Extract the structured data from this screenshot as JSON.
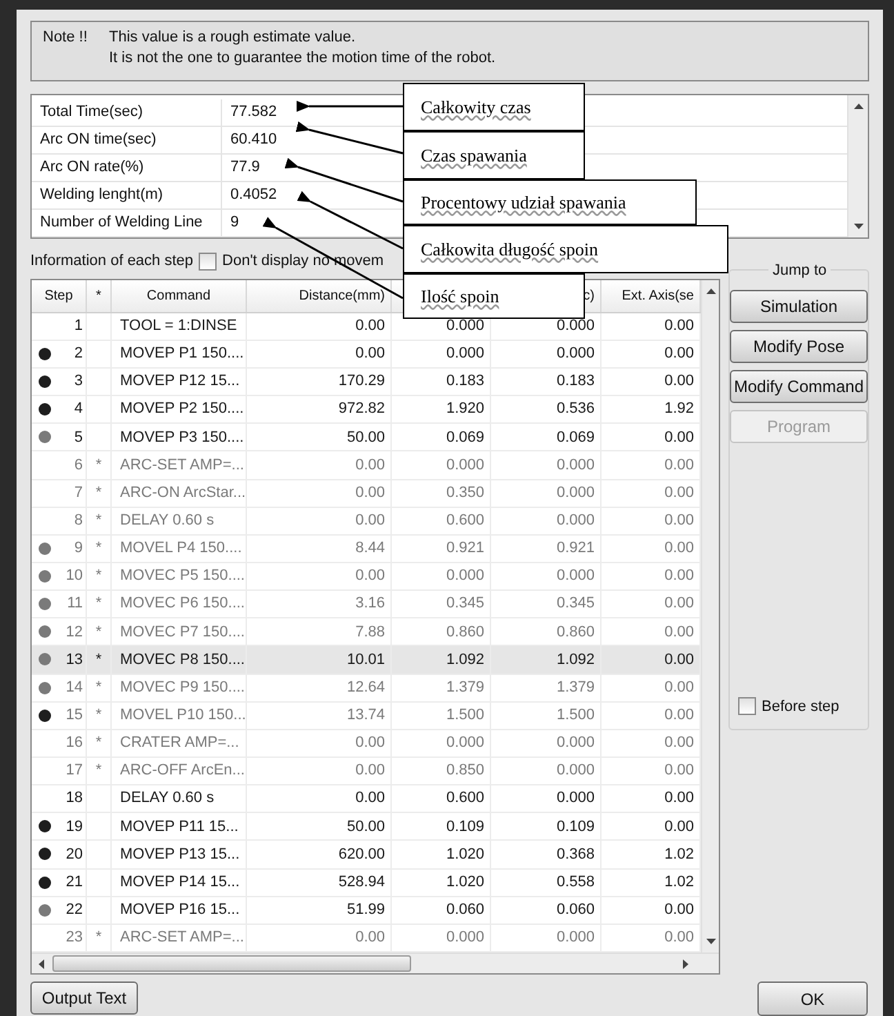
{
  "note": {
    "label": "Note !!",
    "lines": [
      "This value is a rough estimate value.",
      "It is not the one to guarantee the motion time of the robot."
    ]
  },
  "summary": [
    {
      "label": "Total Time(sec)",
      "value": "77.582"
    },
    {
      "label": "Arc ON time(sec)",
      "value": "60.410"
    },
    {
      "label": "Arc ON rate(%)",
      "value": "77.9"
    },
    {
      "label": "Welding lenght(m)",
      "value": "0.4052"
    },
    {
      "label": "Number of Welding Line",
      "value": "9"
    }
  ],
  "step_info": {
    "label": "Information of each step",
    "filter": {
      "label": "Don't display no movem",
      "checked": false
    }
  },
  "table": {
    "columns": [
      {
        "label": "Step"
      },
      {
        "label": "*"
      },
      {
        "label": "Command"
      },
      {
        "label": "Distance(mm)"
      },
      {},
      {
        "label": "c)"
      },
      {
        "label": "Ext. Axis(se"
      }
    ],
    "rows": [
      {
        "step": "1",
        "star": false,
        "command": "TOOL = 1:DINSE",
        "values": [
          "0.00",
          "0.000",
          "0.000",
          "0.00"
        ],
        "dimmed": false,
        "selected": false
      },
      {
        "color": "#1e1e1e",
        "step": "2",
        "star": false,
        "command": "MOVEP P1 150....",
        "values": [
          "0.00",
          "0.000",
          "0.000",
          "0.00"
        ],
        "dimmed": false,
        "selected": false
      },
      {
        "color": "#1e1e1e",
        "step": "3",
        "star": false,
        "command": "MOVEP P12 15...",
        "values": [
          "170.29",
          "0.183",
          "0.183",
          "0.00"
        ],
        "dimmed": false,
        "selected": false
      },
      {
        "color": "#1e1e1e",
        "step": "4",
        "star": false,
        "command": "MOVEP P2 150....",
        "values": [
          "972.82",
          "1.920",
          "0.536",
          "1.92"
        ],
        "dimmed": false,
        "selected": false
      },
      {
        "color": "#7a7a7a",
        "step": "5",
        "star": false,
        "command": "MOVEP P3 150....",
        "values": [
          "50.00",
          "0.069",
          "0.069",
          "0.00"
        ],
        "dimmed": false,
        "selected": false
      },
      {
        "step": "6",
        "star": true,
        "command": "ARC-SET AMP=...",
        "values": [
          "0.00",
          "0.000",
          "0.000",
          "0.00"
        ],
        "dimmed": true,
        "selected": false
      },
      {
        "step": "7",
        "star": true,
        "command": "ARC-ON ArcStar...",
        "values": [
          "0.00",
          "0.350",
          "0.000",
          "0.00"
        ],
        "dimmed": true,
        "selected": false
      },
      {
        "step": "8",
        "star": true,
        "command": "DELAY 0.60 s",
        "values": [
          "0.00",
          "0.600",
          "0.000",
          "0.00"
        ],
        "dimmed": true,
        "selected": false
      },
      {
        "color": "#7a7a7a",
        "step": "9",
        "star": true,
        "command": "MOVEL P4 150....",
        "values": [
          "8.44",
          "0.921",
          "0.921",
          "0.00"
        ],
        "dimmed": true,
        "selected": false
      },
      {
        "color": "#7a7a7a",
        "step": "10",
        "star": true,
        "command": "MOVEC P5 150....",
        "values": [
          "0.00",
          "0.000",
          "0.000",
          "0.00"
        ],
        "dimmed": true,
        "selected": false
      },
      {
        "color": "#7a7a7a",
        "step": "11",
        "star": true,
        "command": "MOVEC P6 150....",
        "values": [
          "3.16",
          "0.345",
          "0.345",
          "0.00"
        ],
        "dimmed": true,
        "selected": false
      },
      {
        "color": "#7a7a7a",
        "step": "12",
        "star": true,
        "command": "MOVEC P7 150....",
        "values": [
          "7.88",
          "0.860",
          "0.860",
          "0.00"
        ],
        "dimmed": true,
        "selected": false
      },
      {
        "color": "#7a7a7a",
        "step": "13",
        "star": true,
        "command": "MOVEC P8 150....",
        "values": [
          "10.01",
          "1.092",
          "1.092",
          "0.00"
        ],
        "dimmed": false,
        "selected": true
      },
      {
        "color": "#7a7a7a",
        "step": "14",
        "star": true,
        "command": "MOVEC P9 150....",
        "values": [
          "12.64",
          "1.379",
          "1.379",
          "0.00"
        ],
        "dimmed": true,
        "selected": false
      },
      {
        "color": "#1e1e1e",
        "step": "15",
        "star": true,
        "command": "MOVEL P10 150...",
        "values": [
          "13.74",
          "1.500",
          "1.500",
          "0.00"
        ],
        "dimmed": true,
        "selected": false
      },
      {
        "step": "16",
        "star": true,
        "command": "CRATER AMP=...",
        "values": [
          "0.00",
          "0.000",
          "0.000",
          "0.00"
        ],
        "dimmed": true,
        "selected": false
      },
      {
        "step": "17",
        "star": true,
        "command": "ARC-OFF ArcEn...",
        "values": [
          "0.00",
          "0.850",
          "0.000",
          "0.00"
        ],
        "dimmed": true,
        "selected": false
      },
      {
        "step": "18",
        "star": false,
        "command": "DELAY 0.60 s",
        "values": [
          "0.00",
          "0.600",
          "0.000",
          "0.00"
        ],
        "dimmed": false,
        "selected": false
      },
      {
        "color": "#1e1e1e",
        "step": "19",
        "star": false,
        "command": "MOVEP P11 15...",
        "values": [
          "50.00",
          "0.109",
          "0.109",
          "0.00"
        ],
        "dimmed": false,
        "selected": false
      },
      {
        "color": "#1e1e1e",
        "step": "20",
        "star": false,
        "command": "MOVEP P13 15...",
        "values": [
          "620.00",
          "1.020",
          "0.368",
          "1.02"
        ],
        "dimmed": false,
        "selected": false
      },
      {
        "color": "#1e1e1e",
        "step": "21",
        "star": false,
        "command": "MOVEP P14 15...",
        "values": [
          "528.94",
          "1.020",
          "0.558",
          "1.02"
        ],
        "dimmed": false,
        "selected": false
      },
      {
        "color": "#7a7a7a",
        "step": "22",
        "star": false,
        "command": "MOVEP P16 15...",
        "values": [
          "51.99",
          "0.060",
          "0.060",
          "0.00"
        ],
        "dimmed": false,
        "selected": false
      },
      {
        "step": "23",
        "star": true,
        "command": "ARC-SET AMP=...",
        "values": [
          "0.00",
          "0.000",
          "0.000",
          "0.00"
        ],
        "dimmed": true,
        "selected": false
      }
    ]
  },
  "jump_to": {
    "title": "Jump to",
    "buttons": [
      {
        "label": "Simulation",
        "disabled": false
      },
      {
        "label": "Modify Pose",
        "disabled": false
      },
      {
        "label": "Modify Command",
        "disabled": false
      },
      {
        "label": "Program",
        "disabled": true
      }
    ],
    "before_step": {
      "label": "Before step",
      "checked": false
    }
  },
  "footer": {
    "output_button": "Output Text",
    "ok_button": "OK"
  },
  "callouts": [
    "Całkowity czas",
    "Czas spawania",
    "Procentowy udział spawania",
    "Całkowita długość spoin",
    "Ilość spoin"
  ]
}
